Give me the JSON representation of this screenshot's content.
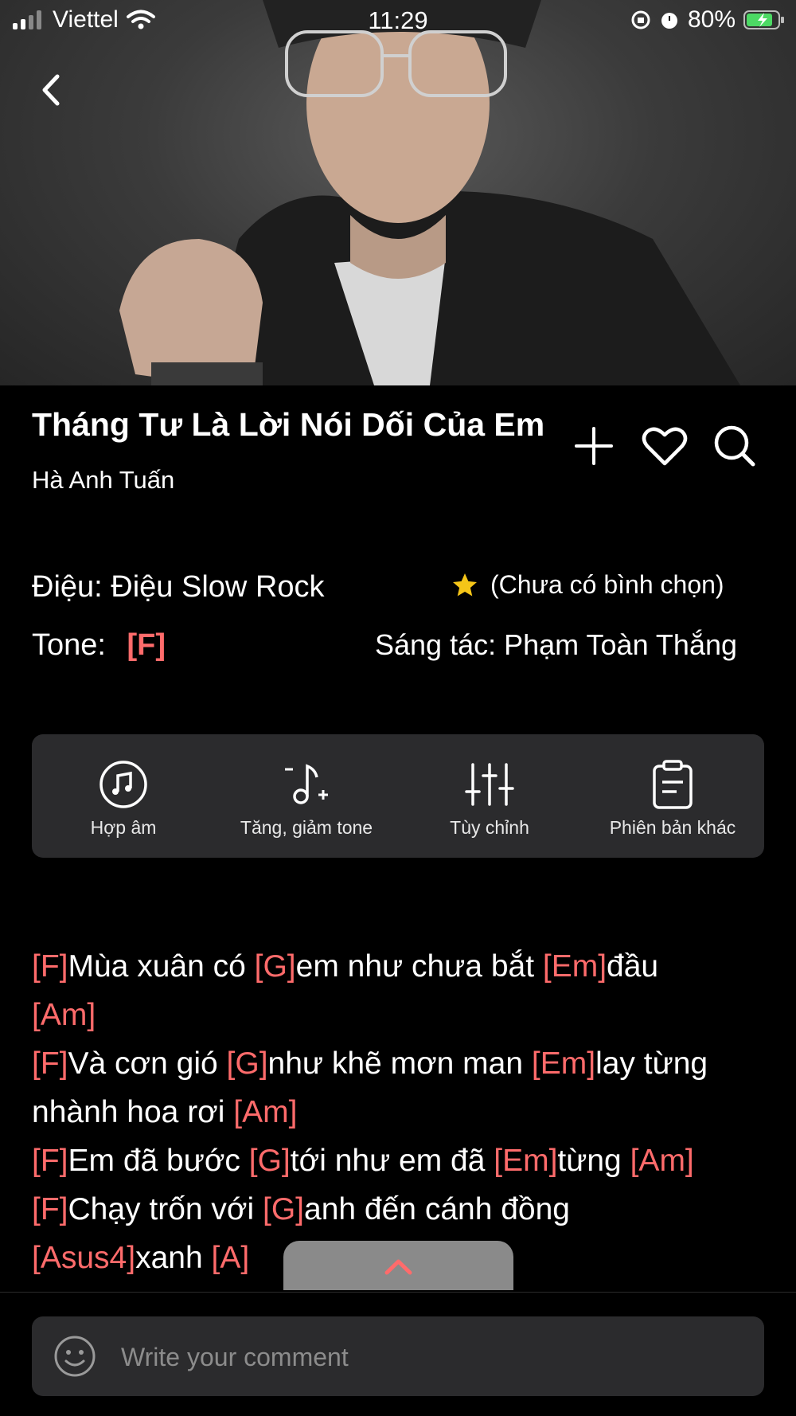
{
  "status_bar": {
    "carrier": "Viettel",
    "time": "11:29",
    "battery": "80%"
  },
  "song": {
    "title": "Tháng Tư Là Lời Nói Dối Của Em",
    "artist": "Hà Anh Tuấn"
  },
  "details": {
    "rhythm_label": "Điệu:",
    "rhythm_value": "Điệu Slow Rock",
    "rating_text": "(Chưa có bình chọn)",
    "tone_label": "Tone:",
    "tone_value": "[F]",
    "composer_label": "Sáng tác:",
    "composer_value": "Phạm Toàn Thắng"
  },
  "tools": [
    {
      "label": "Hợp âm",
      "icon": "music-note-circle-icon"
    },
    {
      "label": "Tăng, giảm tone",
      "icon": "transpose-note-icon"
    },
    {
      "label": "Tùy chỉnh",
      "icon": "sliders-icon"
    },
    {
      "label": "Phiên bản khác",
      "icon": "clipboard-icon"
    }
  ],
  "lyrics": [
    [
      [
        "ch",
        "[F]"
      ],
      [
        "t",
        "Mùa xuân có "
      ],
      [
        "ch",
        "[G]"
      ],
      [
        "t",
        "em như chưa bắt "
      ],
      [
        "ch",
        "[Em]"
      ],
      [
        "t",
        "đầu"
      ]
    ],
    [
      [
        "ch",
        "[Am]"
      ]
    ],
    [
      [
        "ch",
        "[F]"
      ],
      [
        "t",
        "Và cơn gió "
      ],
      [
        "ch",
        "[G]"
      ],
      [
        "t",
        "như khẽ mơn man "
      ],
      [
        "ch",
        "[Em]"
      ],
      [
        "t",
        "lay từng"
      ]
    ],
    [
      [
        "t",
        "nhành hoa rơi "
      ],
      [
        "ch",
        "[Am]"
      ]
    ],
    [
      [
        "ch",
        "[F]"
      ],
      [
        "t",
        "Em đã bước "
      ],
      [
        "ch",
        "[G]"
      ],
      [
        "t",
        "tới như em đã "
      ],
      [
        "ch",
        "[Em]"
      ],
      [
        "t",
        "từng "
      ],
      [
        "ch",
        "[Am]"
      ]
    ],
    [
      [
        "ch",
        "[F]"
      ],
      [
        "t",
        "Chạy trốn với "
      ],
      [
        "ch",
        "[G]"
      ],
      [
        "t",
        "anh đến cánh đồng"
      ]
    ],
    [
      [
        "ch",
        "[Asus4]"
      ],
      [
        "t",
        "xanh "
      ],
      [
        "ch",
        "[A]"
      ]
    ]
  ],
  "comment": {
    "placeholder": "Write your comment"
  },
  "colors": {
    "chord": "#ff6b6b",
    "panel": "#2b2b2d",
    "background": "#000000"
  }
}
